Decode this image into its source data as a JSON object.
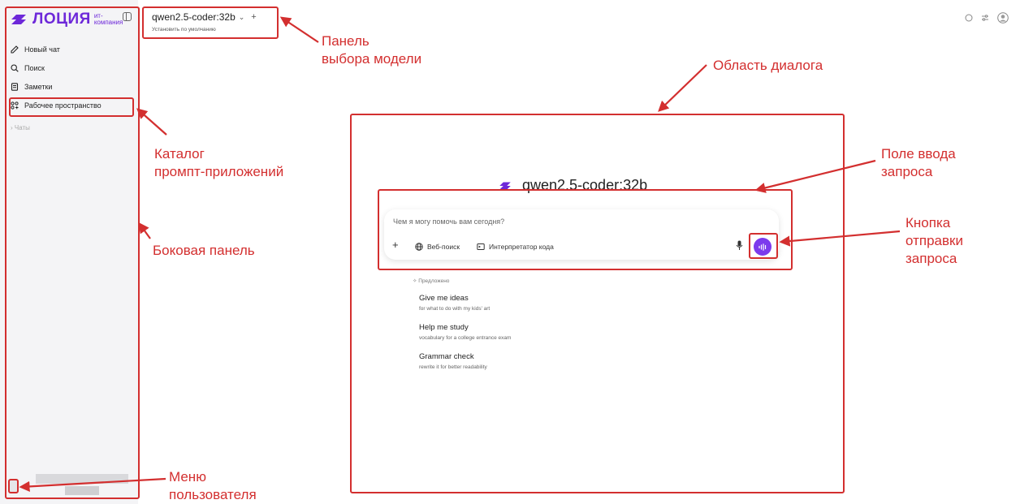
{
  "sidebar": {
    "logo_text": "ЛОЦИЯ",
    "logo_sub_1": "ит-",
    "logo_sub_2": "компания",
    "items": [
      {
        "label": "Новый чат",
        "icon": "edit-icon"
      },
      {
        "label": "Поиск",
        "icon": "search-icon"
      },
      {
        "label": "Заметки",
        "icon": "notes-icon"
      },
      {
        "label": "Рабочее пространство",
        "icon": "workspace-icon"
      }
    ],
    "chats_label": "Чаты"
  },
  "header": {
    "model_name": "qwen2.5-coder:32b",
    "set_default": "Установить по умолчанию"
  },
  "main": {
    "model_title": "qwen2.5-coder:32b",
    "prompt_placeholder": "Чем я могу помочь вам сегодня?",
    "tools": [
      "Веб-поиск",
      "Интерпретатор кода"
    ],
    "suggested_label": "Предложено",
    "suggestions": [
      {
        "title": "Give me ideas",
        "subtitle": "for what to do with my kids' art"
      },
      {
        "title": "Help me study",
        "subtitle": "vocabulary for a college entrance exam"
      },
      {
        "title": "Grammar check",
        "subtitle": "rewrite it for better readability"
      }
    ]
  },
  "annotations": {
    "model_panel": [
      "Панель",
      "выбора модели"
    ],
    "dialog_area": "Область диалога",
    "catalog": [
      "Каталог",
      "промпт-приложений"
    ],
    "sidebar": "Боковая панель",
    "input_field": [
      "Поле ввода",
      "запроса"
    ],
    "send_button": [
      "Кнопка",
      "отправки",
      "запроса"
    ],
    "user_menu": [
      "Меню",
      "пользователя"
    ]
  },
  "colors": {
    "brand": "#6d28d9",
    "send_button": "#7c3aed",
    "annotation": "#d32f2f",
    "sidebar_bg": "#f4f4f6"
  }
}
